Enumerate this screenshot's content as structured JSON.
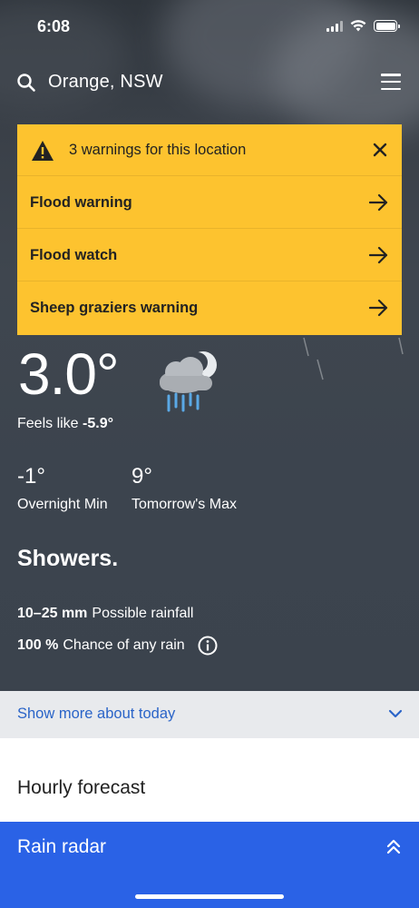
{
  "status_bar": {
    "time": "6:08"
  },
  "header": {
    "location": "Orange, NSW",
    "icons": [
      "search-icon",
      "menu-icon"
    ]
  },
  "warnings": {
    "title": "3 warnings for this location",
    "items": [
      {
        "label": "Flood warning"
      },
      {
        "label": "Flood watch"
      },
      {
        "label": "Sheep graziers warning"
      }
    ],
    "color": "#fdc32f"
  },
  "current": {
    "temperature": "3.0°",
    "feels_like_label": "Feels like",
    "feels_like_value": "-5.9°",
    "icon": "showers-partly-cloudy-night-icon"
  },
  "forecast": {
    "min_value": "-1°",
    "min_label": "Overnight Min",
    "max_value": "9°",
    "max_label": "Tomorrow's Max",
    "summary": "Showers.",
    "rainfall_value": "10–25 mm",
    "rainfall_label": "Possible rainfall",
    "chance_value": "100 %",
    "chance_label": "Chance of any rain"
  },
  "sections": {
    "show_more": "Show more about today",
    "hourly": "Hourly forecast",
    "radar": "Rain radar"
  },
  "colors": {
    "accent": "#2a62e6",
    "link": "#2a64c8"
  }
}
